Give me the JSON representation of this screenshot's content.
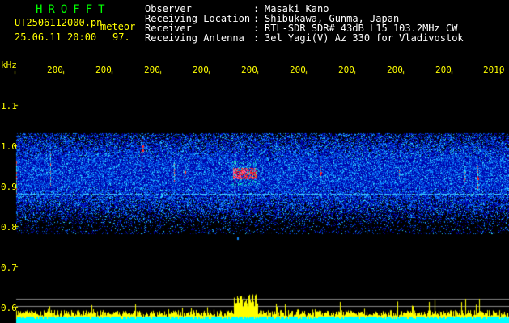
{
  "header": {
    "site_name": "HROFFT",
    "file_name": "UT2506112000.pn",
    "mode_label": "meteor",
    "date_time": "25.06.11 20:00",
    "count": "97.",
    "labels": [
      "Observer",
      "Receiving Location",
      "Receiver",
      "Receiving Antenna"
    ],
    "colons": [
      ":",
      ":",
      ":",
      ":"
    ],
    "values": [
      "Masaki Kano",
      "Shibukawa, Gunma, Japan",
      "RTL-SDR SDR# 43dB L15 103.2MHz CW",
      "3el Yagi(V) Az 330 for Vladivostok"
    ]
  },
  "spectrogram": {
    "freq_unit": "kHz",
    "freq_ticks": [
      "1.1",
      "1.0",
      "0.9",
      "0.8",
      "0.7",
      "0.6"
    ],
    "time_ticks": [
      "200",
      "200",
      "200",
      "200",
      "200",
      "200",
      "200",
      "200",
      "200",
      "2010"
    ],
    "palette": {
      "background": "#000000",
      "noise_low": "#0000aa",
      "noise_high": "#00ccff",
      "echo_hot": "#ff2020",
      "bar_fill": "#ffff00",
      "baseline": "#00ffff",
      "text": "#ffff00"
    }
  }
}
